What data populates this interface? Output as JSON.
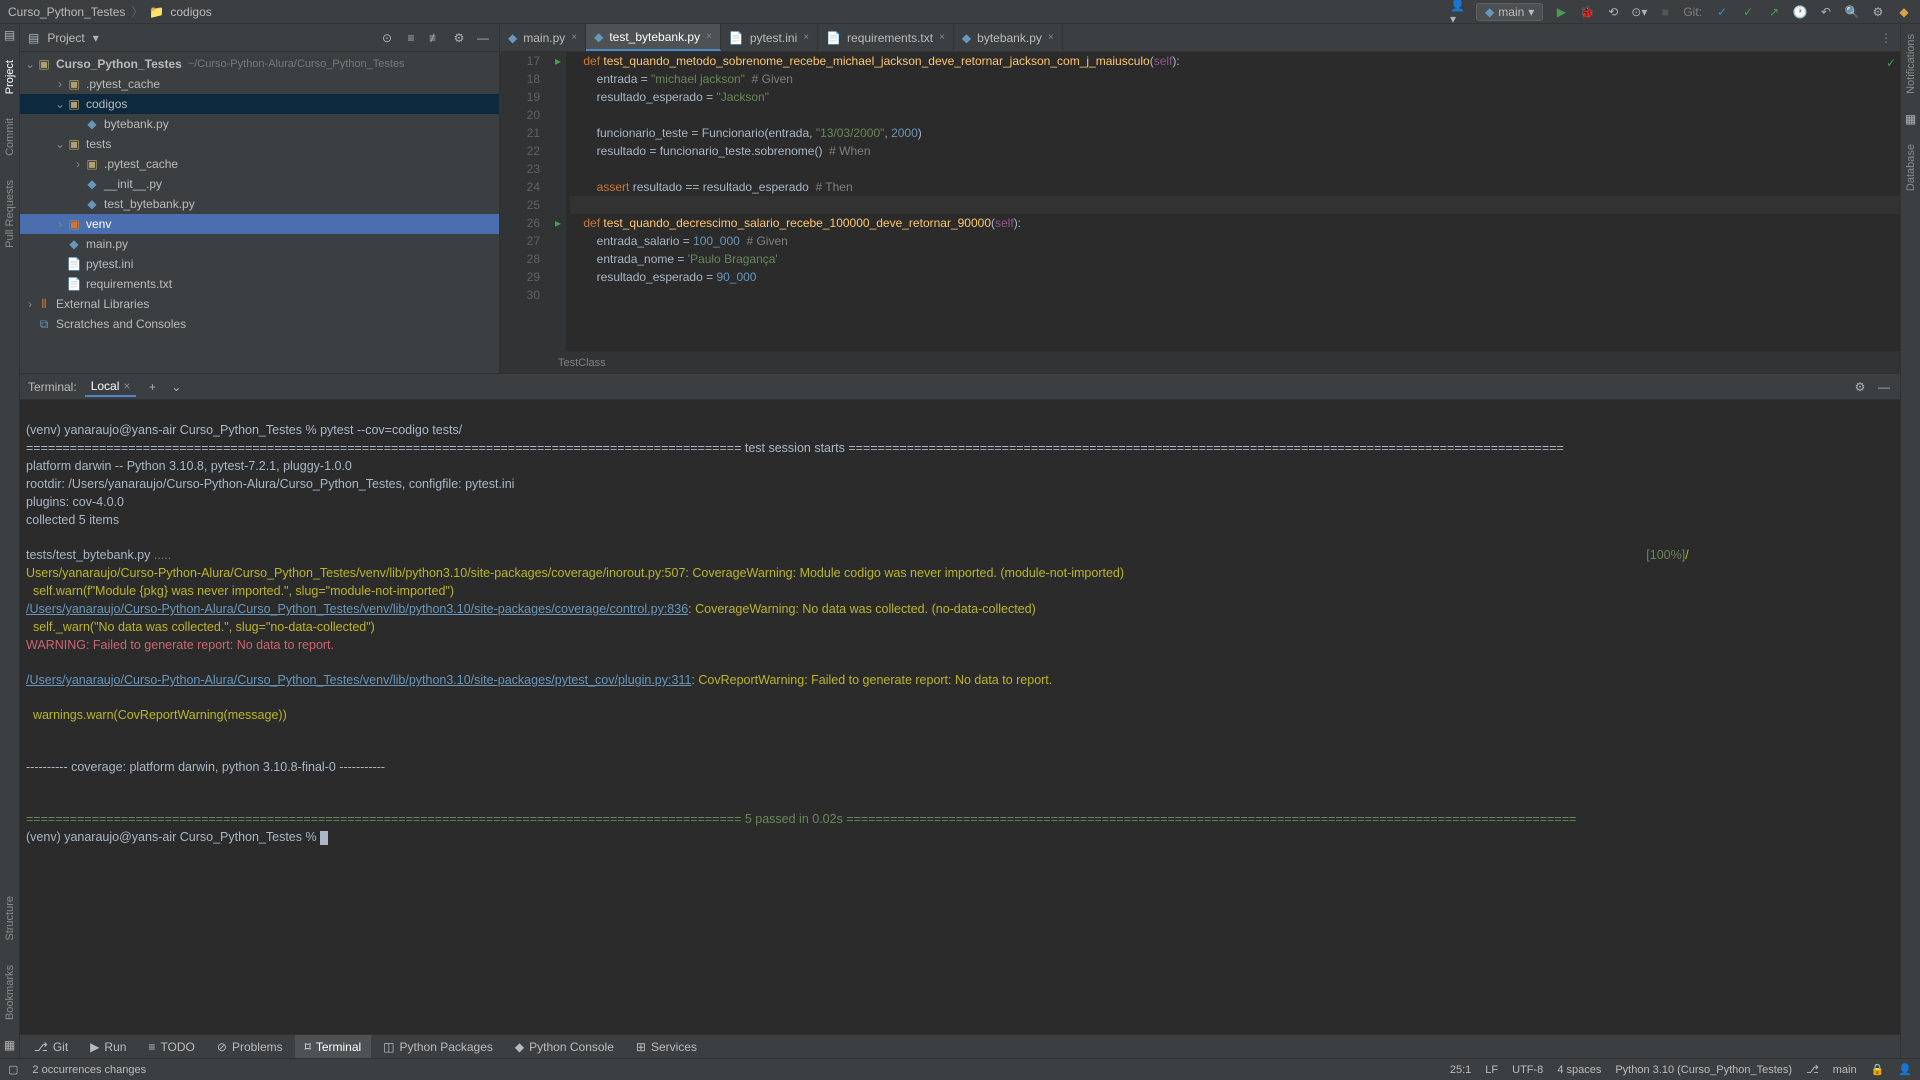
{
  "breadcrumb": {
    "project": "Curso_Python_Testes",
    "folder": "codigos",
    "folder_icon": "📁"
  },
  "topbar": {
    "branch": "main",
    "git_label": "Git:"
  },
  "project": {
    "title": "Project",
    "root": "Curso_Python_Testes",
    "root_hint": "~/Curso-Python-Alura/Curso_Python_Testes",
    "items": [
      {
        "name": ".pytest_cache",
        "type": "folder",
        "depth": 1,
        "arrow": "›"
      },
      {
        "name": "codigos",
        "type": "folder",
        "depth": 1,
        "arrow": "⌄",
        "selected": true
      },
      {
        "name": "bytebank.py",
        "type": "py",
        "depth": 2
      },
      {
        "name": "tests",
        "type": "folder",
        "depth": 1,
        "arrow": "⌄"
      },
      {
        "name": ".pytest_cache",
        "type": "folder",
        "depth": 2,
        "arrow": "›"
      },
      {
        "name": "__init__.py",
        "type": "py",
        "depth": 2
      },
      {
        "name": "test_bytebank.py",
        "type": "py",
        "depth": 2
      },
      {
        "name": "venv",
        "type": "folder-orange",
        "depth": 1,
        "arrow": "›",
        "highlight": true
      },
      {
        "name": "main.py",
        "type": "py",
        "depth": 1
      },
      {
        "name": "pytest.ini",
        "type": "file",
        "depth": 1
      },
      {
        "name": "requirements.txt",
        "type": "file",
        "depth": 1
      }
    ],
    "external": "External Libraries",
    "scratches": "Scratches and Consoles"
  },
  "tabs": [
    {
      "label": "main.py",
      "icon": "py"
    },
    {
      "label": "test_bytebank.py",
      "icon": "py",
      "active": true
    },
    {
      "label": "pytest.ini",
      "icon": "file"
    },
    {
      "label": "requirements.txt",
      "icon": "file"
    },
    {
      "label": "bytebank.py",
      "icon": "py"
    }
  ],
  "editor": {
    "breadcrumb": "TestClass",
    "lines": [
      {
        "n": 17,
        "run": true,
        "html": "    <span class='kw'>def</span> <span class='fn'>test_quando_metodo_sobrenome_recebe_michael_jackson_deve_retornar_jackson_com_j_maiusculo</span>(<span class='self'>self</span>):"
      },
      {
        "n": 18,
        "html": "        entrada = <span class='str'>\"michael jackson\"</span>  <span class='comment'># Given</span>"
      },
      {
        "n": 19,
        "html": "        resultado_esperado = <span class='str'>\"Jackson\"</span>"
      },
      {
        "n": 20,
        "html": ""
      },
      {
        "n": 21,
        "html": "        funcionario_teste = Funcionario(entrada, <span class='str'>\"13/03/2000\"</span>, <span class='num'>2000</span>)"
      },
      {
        "n": 22,
        "html": "        resultado = funcionario_teste.sobrenome()  <span class='comment'># When</span>"
      },
      {
        "n": 23,
        "html": ""
      },
      {
        "n": 24,
        "html": "        <span class='kw'>assert</span> resultado == resultado_esperado  <span class='comment'># Then</span>"
      },
      {
        "n": 25,
        "html": "",
        "current": true
      },
      {
        "n": 26,
        "run": true,
        "html": "    <span class='kw'>def</span> <span class='fn'>test_quando_decrescimo_salario_recebe_100000_deve_retornar_90000</span>(<span class='self'>self</span>):"
      },
      {
        "n": 27,
        "html": "        entrada_salario = <span class='num'>100_000</span>  <span class='comment'># Given</span>"
      },
      {
        "n": 28,
        "html": "        entrada_nome = <span class='str'>'Paulo Bragança'</span>"
      },
      {
        "n": 29,
        "html": "        resultado_esperado = <span class='num'>90_000</span>"
      },
      {
        "n": 30,
        "html": ""
      }
    ]
  },
  "terminal": {
    "header": "Terminal:",
    "tab": "Local",
    "prompt1": "(venv) yanaraujo@yans-air Curso_Python_Testes % pytest --cov=codigo tests/",
    "session_line": "================================================================================================== test session starts ==================================================================================================",
    "platform": "platform darwin -- Python 3.10.8, pytest-7.2.1, pluggy-1.0.0",
    "rootdir": "rootdir: /Users/yanaraujo/Curso-Python-Alura/Curso_Python_Testes, configfile: pytest.ini",
    "plugins": "plugins: cov-4.0.0",
    "collected": "collected 5 items",
    "test_file": "tests/test_bytebank.py ",
    "dots": ".....",
    "percent": "[100%]",
    "warn1a": "Users/yanaraujo/Curso-Python-Alura/Curso_Python_Testes/venv/lib/python3.10/site-packages/coverage/inorout.py:507: CoverageWarning: Module codigo was never imported. (module-not-imported)",
    "warn1b": "  self.warn(f\"Module {pkg} was never imported.\", slug=\"module-not-imported\")",
    "link2": "/Users/yanaraujo/Curso-Python-Alura/Curso_Python_Testes/venv/lib/python3.10/site-packages/coverage/control.py:836",
    "warn2a": ": CoverageWarning: No data was collected. (no-data-collected)",
    "warn2b": "  self._warn(\"No data was collected.\", slug=\"no-data-collected\")",
    "warn3": "WARNING: Failed to generate report: No data to report.",
    "link4": "/Users/yanaraujo/Curso-Python-Alura/Curso_Python_Testes/venv/lib/python3.10/site-packages/pytest_cov/plugin.py:311",
    "warn4a": ": CovReportWarning: Failed to generate report: No data to report.",
    "warn4b": "  warnings.warn(CovReportWarning(message))",
    "cov_line": "---------- coverage: platform darwin, python 3.10.8-final-0 -----------",
    "passed_line": "================================================================================================== 5 passed in 0.02s ====================================================================================================",
    "prompt2": "(venv) yanaraujo@yans-air Curso_Python_Testes % "
  },
  "bottom_tabs": [
    {
      "label": "Git"
    },
    {
      "label": "Run"
    },
    {
      "label": "TODO"
    },
    {
      "label": "Problems"
    },
    {
      "label": "Terminal",
      "active": true
    },
    {
      "label": "Python Packages"
    },
    {
      "label": "Python Console"
    },
    {
      "label": "Services"
    }
  ],
  "status": {
    "changes": "2 occurrences changes",
    "pos": "25:1",
    "eol": "LF",
    "enc": "UTF-8",
    "indent": "4 spaces",
    "interpreter": "Python 3.10 (Curso_Python_Testes)",
    "branch": "main"
  },
  "left_gutter": [
    "Project",
    "Commit",
    "Pull Requests",
    "Structure",
    "Bookmarks"
  ],
  "right_gutter": [
    "Notifications",
    "Database"
  ]
}
